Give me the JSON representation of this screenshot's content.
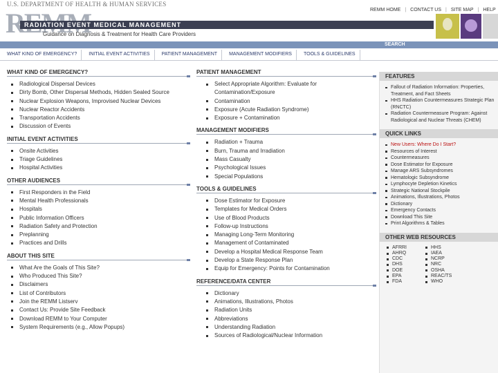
{
  "header": {
    "agency": "U.S. DEPARTMENT OF HEALTH & HUMAN SERVICES",
    "logo": "REMM",
    "title": "RADIATION EVENT MEDICAL MANAGEMENT",
    "subtitle": "Guidance on Diagnosis & Treatment for Health Care Providers",
    "top_links": [
      "REMM HOME",
      "CONTACT US",
      "SITE MAP",
      "HELP"
    ]
  },
  "search": {
    "label": "SEARCH"
  },
  "nav": [
    "WHAT KIND OF EMERGENCY?",
    "INITIAL EVENT ACTIVITIES",
    "PATIENT MANAGEMENT",
    "MANAGEMENT MODIFIERS",
    "TOOLS & GUIDELINES"
  ],
  "left": {
    "emergency": {
      "title": "WHAT KIND OF EMERGENCY?",
      "items": [
        "Radiological Dispersal Devices",
        "Dirty Bomb, Other Dispersal Methods, Hidden Sealed Source",
        "Nuclear Explosion Weapons, Improvised Nuclear Devices",
        "Nuclear Reactor Accidents",
        "Transportation Accidents",
        "Discussion of Events"
      ]
    },
    "initial": {
      "title": "INITIAL EVENT ACTIVITIES",
      "items": [
        "Onsite Activities",
        "Triage Guidelines",
        "Hospital Activities"
      ]
    },
    "audiences": {
      "title": "OTHER AUDIENCES",
      "items": [
        "First Responders in the Field",
        "Mental Health Professionals",
        "Hospitals",
        "Public Information Officers",
        "Radiation Safety and Protection",
        "Preplanning",
        "Practices and Drills"
      ]
    },
    "about": {
      "title": "ABOUT THIS SITE",
      "items": [
        "What Are the Goals of This Site?",
        "Who Produced This Site?",
        "Disclaimers",
        "List of Contributors",
        "Join the REMM Listserv",
        "Contact Us: Provide Site Feedback",
        "Download REMM to Your Computer",
        "System Requirements (e.g., Allow Popups)"
      ]
    }
  },
  "middle": {
    "patient": {
      "title": "PATIENT MANAGEMENT",
      "items": [
        "Select Appropriate Algorithm: Evaluate for Contamination/Exposure",
        "Contamination",
        "Exposure (Acute Radiation Syndrome)",
        "Exposure + Contamination"
      ]
    },
    "modifiers": {
      "title": "MANAGEMENT MODIFIERS",
      "items": [
        "Radiation + Trauma",
        "Burn, Trauma and Irradiation",
        "Mass Casualty",
        "Psychological Issues",
        "Special Populations"
      ]
    },
    "tools": {
      "title": "TOOLS & GUIDELINES",
      "items": [
        "Dose Estimator for Exposure",
        "Templates for Medical Orders",
        "Use of Blood Products",
        "Follow-up Instructions",
        "Managing Long-Term Monitoring",
        "Management of Contaminated",
        "Develop a Hospital Medical Response Team",
        "Develop a State Response Plan",
        "Equip for Emergency: Points for Contamination"
      ]
    },
    "reference": {
      "title": "REFERENCE/DATA CENTER",
      "items": [
        "Dictionary",
        "Animations, Illustrations, Photos",
        "Radiation Units",
        "Abbreviations",
        "Understanding Radiation",
        "Sources of Radiological/Nuclear Information"
      ]
    }
  },
  "sidebar": {
    "features": {
      "title": "FEATURES",
      "items": [
        "Fallout of Radiation Information: Properties, Treatment, and Fact Sheets",
        "HHS Radiation Countermeasures Strategic Plan (RNCTC)",
        "Radiation Countermeasure Program: Against Radiological and Nuclear Threats (CHEM)"
      ]
    },
    "quick": {
      "title": "QUICK LINKS",
      "items": [
        "New Users: Where Do I Start?",
        "Resources of Interest",
        "Countermeasures",
        "Dose Estimator for Exposure",
        "Manage ARS Subsyndromes",
        "Hematologic Subsyndrome",
        "Lymphocyte Depletion Kinetics",
        "Strategic National Stockpile",
        "Animations, Illustrations, Photos",
        "Dictionary",
        "Emergency Contacts",
        "Download This Site",
        "Print Algorithms & Tables"
      ]
    },
    "resources": {
      "title": "OTHER WEB RESOURCES",
      "items": [
        "AFRRI",
        "HHS",
        "AHRQ",
        "IAEA",
        "CDC",
        "NCRP",
        "DHS",
        "NRC",
        "DOE",
        "OSHA",
        "EPA",
        "REAC/TS",
        "FDA",
        "WHO"
      ]
    }
  },
  "colors": {
    "title_bar": "#3b3f52",
    "search_bar": "#7b93b9",
    "nav_text": "#2b3a6b",
    "highlight": "#b11111"
  }
}
